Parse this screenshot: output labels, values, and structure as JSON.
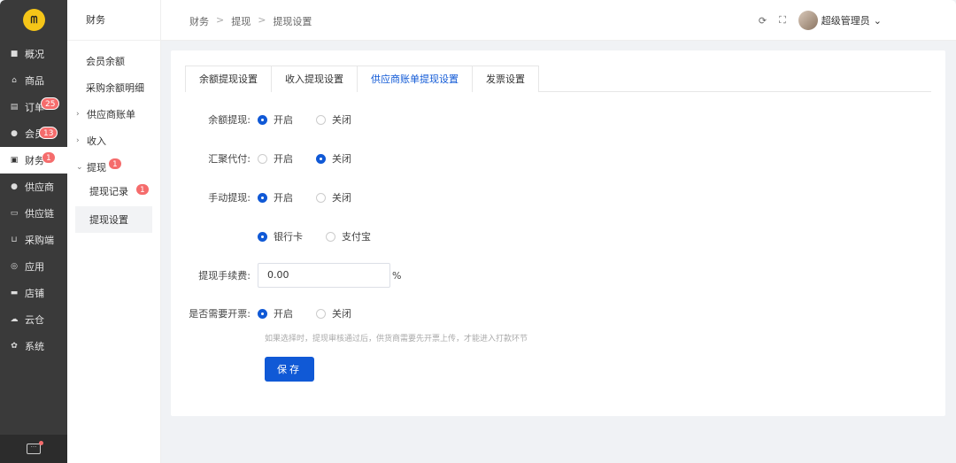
{
  "rail": {
    "items": [
      {
        "label": "概况",
        "icon": "monitor-icon"
      },
      {
        "label": "商品",
        "icon": "home-icon"
      },
      {
        "label": "订单",
        "icon": "clipboard-icon",
        "badge": "25"
      },
      {
        "label": "会员",
        "icon": "user-icon",
        "badge": "13"
      },
      {
        "label": "财务",
        "icon": "wallet-icon",
        "badge": "1"
      },
      {
        "label": "供应商",
        "icon": "user-icon"
      },
      {
        "label": "供应链",
        "icon": "truck-icon"
      },
      {
        "label": "采购端",
        "icon": "cart-icon"
      },
      {
        "label": "应用",
        "icon": "gear-icon"
      },
      {
        "label": "店铺",
        "icon": "store-icon"
      },
      {
        "label": "云仓",
        "icon": "cloud-icon"
      },
      {
        "label": "系统",
        "icon": "settings-icon"
      }
    ]
  },
  "subnav": {
    "title": "财务",
    "items": {
      "member_balance": "会员余额",
      "purchase_balance": "采购余额明细",
      "supplier_bill": "供应商账单",
      "income": "收入",
      "withdraw": "提现",
      "withdraw_badge": "1",
      "withdraw_records": "提现记录",
      "withdraw_records_badge": "1",
      "withdraw_settings": "提现设置"
    }
  },
  "breadcrumb": {
    "a": "财务",
    "b": "提现",
    "c": "提现设置",
    "sep": ">"
  },
  "topbar": {
    "user": "超级管理员"
  },
  "tabs": [
    "余额提现设置",
    "收入提现设置",
    "供应商账单提现设置",
    "发票设置"
  ],
  "form": {
    "balance_withdraw": {
      "label": "余额提现:",
      "on": "开启",
      "off": "关闭"
    },
    "aggregate_pay": {
      "label": "汇聚代付:",
      "on": "开启",
      "off": "关闭"
    },
    "manual_withdraw": {
      "label": "手动提现:",
      "on": "开启",
      "off": "关闭"
    },
    "channel": {
      "bank": "银行卡",
      "alipay": "支付宝"
    },
    "fee": {
      "label": "提现手续费:",
      "value": "0.00",
      "unit": "%"
    },
    "invoice": {
      "label": "是否需要开票:",
      "on": "开启",
      "off": "关闭",
      "hint": "如果选择时，提现审核通过后，供货商需要先开票上传，才能进入打款环节"
    },
    "save": "保存"
  },
  "colors": {
    "primary": "#1059d6",
    "badge": "#f56c6c",
    "rail": "#3a3a3a"
  }
}
